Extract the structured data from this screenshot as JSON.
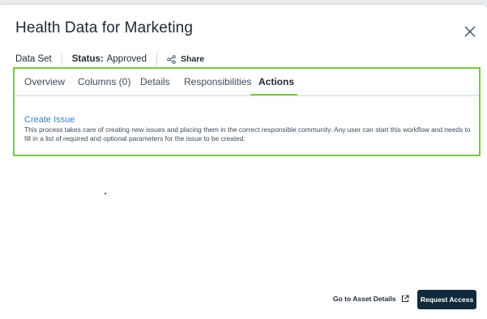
{
  "dialog": {
    "title": "Health Data for Marketing",
    "asset_type": "Data Set",
    "status_label": "Status:",
    "status_value": "Approved",
    "share_label": "Share"
  },
  "tabs": [
    {
      "label": "Overview",
      "active": false
    },
    {
      "label": "Columns (0)",
      "active": false
    },
    {
      "label": "Details",
      "active": false
    },
    {
      "label": "Responsibilities",
      "active": false
    },
    {
      "label": "Actions",
      "active": true
    }
  ],
  "actions": [
    {
      "title": "Create Issue",
      "description": "This process takes care of creating new issues and placing them in the correct responsible community. Any user can start this workflow and needs to fill in a list of required and optional parameters for the issue to be created."
    }
  ],
  "footer": {
    "asset_details_label": "Go to Asset Details",
    "request_access_label": "Request Access"
  },
  "colors": {
    "accent_green": "#7ac943",
    "link_blue": "#3f7fca",
    "primary_button": "#102a3c"
  },
  "icons": {
    "close": "close-icon",
    "share": "share-icon",
    "external": "external-link-icon"
  }
}
